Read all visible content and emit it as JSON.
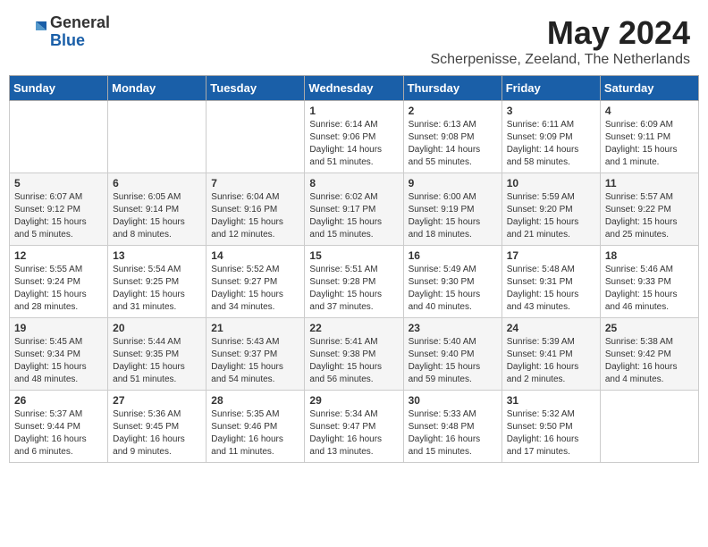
{
  "header": {
    "logo_general": "General",
    "logo_blue": "Blue",
    "month": "May 2024",
    "location": "Scherpenisse, Zeeland, The Netherlands"
  },
  "weekdays": [
    "Sunday",
    "Monday",
    "Tuesday",
    "Wednesday",
    "Thursday",
    "Friday",
    "Saturday"
  ],
  "weeks": [
    [
      {
        "day": "",
        "info": ""
      },
      {
        "day": "",
        "info": ""
      },
      {
        "day": "",
        "info": ""
      },
      {
        "day": "1",
        "info": "Sunrise: 6:14 AM\nSunset: 9:06 PM\nDaylight: 14 hours\nand 51 minutes."
      },
      {
        "day": "2",
        "info": "Sunrise: 6:13 AM\nSunset: 9:08 PM\nDaylight: 14 hours\nand 55 minutes."
      },
      {
        "day": "3",
        "info": "Sunrise: 6:11 AM\nSunset: 9:09 PM\nDaylight: 14 hours\nand 58 minutes."
      },
      {
        "day": "4",
        "info": "Sunrise: 6:09 AM\nSunset: 9:11 PM\nDaylight: 15 hours\nand 1 minute."
      }
    ],
    [
      {
        "day": "5",
        "info": "Sunrise: 6:07 AM\nSunset: 9:12 PM\nDaylight: 15 hours\nand 5 minutes."
      },
      {
        "day": "6",
        "info": "Sunrise: 6:05 AM\nSunset: 9:14 PM\nDaylight: 15 hours\nand 8 minutes."
      },
      {
        "day": "7",
        "info": "Sunrise: 6:04 AM\nSunset: 9:16 PM\nDaylight: 15 hours\nand 12 minutes."
      },
      {
        "day": "8",
        "info": "Sunrise: 6:02 AM\nSunset: 9:17 PM\nDaylight: 15 hours\nand 15 minutes."
      },
      {
        "day": "9",
        "info": "Sunrise: 6:00 AM\nSunset: 9:19 PM\nDaylight: 15 hours\nand 18 minutes."
      },
      {
        "day": "10",
        "info": "Sunrise: 5:59 AM\nSunset: 9:20 PM\nDaylight: 15 hours\nand 21 minutes."
      },
      {
        "day": "11",
        "info": "Sunrise: 5:57 AM\nSunset: 9:22 PM\nDaylight: 15 hours\nand 25 minutes."
      }
    ],
    [
      {
        "day": "12",
        "info": "Sunrise: 5:55 AM\nSunset: 9:24 PM\nDaylight: 15 hours\nand 28 minutes."
      },
      {
        "day": "13",
        "info": "Sunrise: 5:54 AM\nSunset: 9:25 PM\nDaylight: 15 hours\nand 31 minutes."
      },
      {
        "day": "14",
        "info": "Sunrise: 5:52 AM\nSunset: 9:27 PM\nDaylight: 15 hours\nand 34 minutes."
      },
      {
        "day": "15",
        "info": "Sunrise: 5:51 AM\nSunset: 9:28 PM\nDaylight: 15 hours\nand 37 minutes."
      },
      {
        "day": "16",
        "info": "Sunrise: 5:49 AM\nSunset: 9:30 PM\nDaylight: 15 hours\nand 40 minutes."
      },
      {
        "day": "17",
        "info": "Sunrise: 5:48 AM\nSunset: 9:31 PM\nDaylight: 15 hours\nand 43 minutes."
      },
      {
        "day": "18",
        "info": "Sunrise: 5:46 AM\nSunset: 9:33 PM\nDaylight: 15 hours\nand 46 minutes."
      }
    ],
    [
      {
        "day": "19",
        "info": "Sunrise: 5:45 AM\nSunset: 9:34 PM\nDaylight: 15 hours\nand 48 minutes."
      },
      {
        "day": "20",
        "info": "Sunrise: 5:44 AM\nSunset: 9:35 PM\nDaylight: 15 hours\nand 51 minutes."
      },
      {
        "day": "21",
        "info": "Sunrise: 5:43 AM\nSunset: 9:37 PM\nDaylight: 15 hours\nand 54 minutes."
      },
      {
        "day": "22",
        "info": "Sunrise: 5:41 AM\nSunset: 9:38 PM\nDaylight: 15 hours\nand 56 minutes."
      },
      {
        "day": "23",
        "info": "Sunrise: 5:40 AM\nSunset: 9:40 PM\nDaylight: 15 hours\nand 59 minutes."
      },
      {
        "day": "24",
        "info": "Sunrise: 5:39 AM\nSunset: 9:41 PM\nDaylight: 16 hours\nand 2 minutes."
      },
      {
        "day": "25",
        "info": "Sunrise: 5:38 AM\nSunset: 9:42 PM\nDaylight: 16 hours\nand 4 minutes."
      }
    ],
    [
      {
        "day": "26",
        "info": "Sunrise: 5:37 AM\nSunset: 9:44 PM\nDaylight: 16 hours\nand 6 minutes."
      },
      {
        "day": "27",
        "info": "Sunrise: 5:36 AM\nSunset: 9:45 PM\nDaylight: 16 hours\nand 9 minutes."
      },
      {
        "day": "28",
        "info": "Sunrise: 5:35 AM\nSunset: 9:46 PM\nDaylight: 16 hours\nand 11 minutes."
      },
      {
        "day": "29",
        "info": "Sunrise: 5:34 AM\nSunset: 9:47 PM\nDaylight: 16 hours\nand 13 minutes."
      },
      {
        "day": "30",
        "info": "Sunrise: 5:33 AM\nSunset: 9:48 PM\nDaylight: 16 hours\nand 15 minutes."
      },
      {
        "day": "31",
        "info": "Sunrise: 5:32 AM\nSunset: 9:50 PM\nDaylight: 16 hours\nand 17 minutes."
      },
      {
        "day": "",
        "info": ""
      }
    ]
  ]
}
